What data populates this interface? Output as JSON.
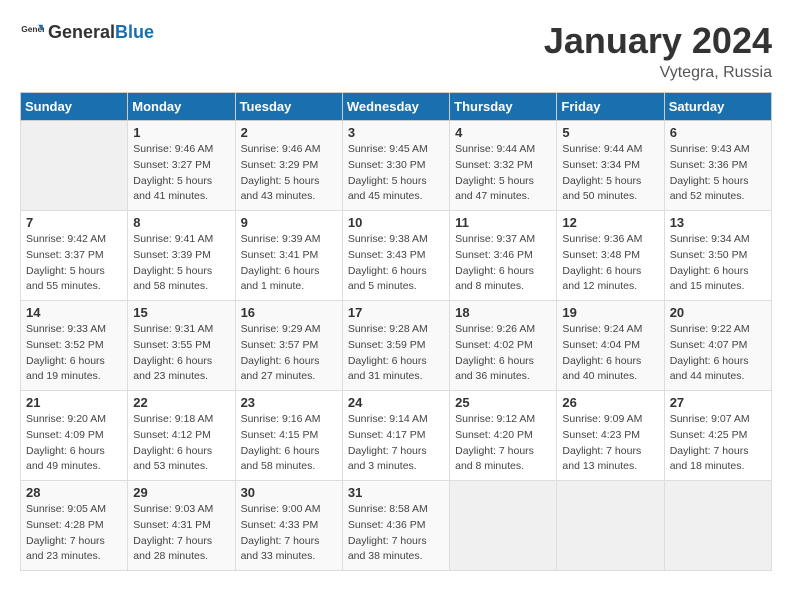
{
  "header": {
    "logo_general": "General",
    "logo_blue": "Blue",
    "month_title": "January 2024",
    "location": "Vytegra, Russia"
  },
  "days_of_week": [
    "Sunday",
    "Monday",
    "Tuesday",
    "Wednesday",
    "Thursday",
    "Friday",
    "Saturday"
  ],
  "weeks": [
    [
      {
        "day": "",
        "info": ""
      },
      {
        "day": "1",
        "info": "Sunrise: 9:46 AM\nSunset: 3:27 PM\nDaylight: 5 hours\nand 41 minutes."
      },
      {
        "day": "2",
        "info": "Sunrise: 9:46 AM\nSunset: 3:29 PM\nDaylight: 5 hours\nand 43 minutes."
      },
      {
        "day": "3",
        "info": "Sunrise: 9:45 AM\nSunset: 3:30 PM\nDaylight: 5 hours\nand 45 minutes."
      },
      {
        "day": "4",
        "info": "Sunrise: 9:44 AM\nSunset: 3:32 PM\nDaylight: 5 hours\nand 47 minutes."
      },
      {
        "day": "5",
        "info": "Sunrise: 9:44 AM\nSunset: 3:34 PM\nDaylight: 5 hours\nand 50 minutes."
      },
      {
        "day": "6",
        "info": "Sunrise: 9:43 AM\nSunset: 3:36 PM\nDaylight: 5 hours\nand 52 minutes."
      }
    ],
    [
      {
        "day": "7",
        "info": "Sunrise: 9:42 AM\nSunset: 3:37 PM\nDaylight: 5 hours\nand 55 minutes."
      },
      {
        "day": "8",
        "info": "Sunrise: 9:41 AM\nSunset: 3:39 PM\nDaylight: 5 hours\nand 58 minutes."
      },
      {
        "day": "9",
        "info": "Sunrise: 9:39 AM\nSunset: 3:41 PM\nDaylight: 6 hours\nand 1 minute."
      },
      {
        "day": "10",
        "info": "Sunrise: 9:38 AM\nSunset: 3:43 PM\nDaylight: 6 hours\nand 5 minutes."
      },
      {
        "day": "11",
        "info": "Sunrise: 9:37 AM\nSunset: 3:46 PM\nDaylight: 6 hours\nand 8 minutes."
      },
      {
        "day": "12",
        "info": "Sunrise: 9:36 AM\nSunset: 3:48 PM\nDaylight: 6 hours\nand 12 minutes."
      },
      {
        "day": "13",
        "info": "Sunrise: 9:34 AM\nSunset: 3:50 PM\nDaylight: 6 hours\nand 15 minutes."
      }
    ],
    [
      {
        "day": "14",
        "info": "Sunrise: 9:33 AM\nSunset: 3:52 PM\nDaylight: 6 hours\nand 19 minutes."
      },
      {
        "day": "15",
        "info": "Sunrise: 9:31 AM\nSunset: 3:55 PM\nDaylight: 6 hours\nand 23 minutes."
      },
      {
        "day": "16",
        "info": "Sunrise: 9:29 AM\nSunset: 3:57 PM\nDaylight: 6 hours\nand 27 minutes."
      },
      {
        "day": "17",
        "info": "Sunrise: 9:28 AM\nSunset: 3:59 PM\nDaylight: 6 hours\nand 31 minutes."
      },
      {
        "day": "18",
        "info": "Sunrise: 9:26 AM\nSunset: 4:02 PM\nDaylight: 6 hours\nand 36 minutes."
      },
      {
        "day": "19",
        "info": "Sunrise: 9:24 AM\nSunset: 4:04 PM\nDaylight: 6 hours\nand 40 minutes."
      },
      {
        "day": "20",
        "info": "Sunrise: 9:22 AM\nSunset: 4:07 PM\nDaylight: 6 hours\nand 44 minutes."
      }
    ],
    [
      {
        "day": "21",
        "info": "Sunrise: 9:20 AM\nSunset: 4:09 PM\nDaylight: 6 hours\nand 49 minutes."
      },
      {
        "day": "22",
        "info": "Sunrise: 9:18 AM\nSunset: 4:12 PM\nDaylight: 6 hours\nand 53 minutes."
      },
      {
        "day": "23",
        "info": "Sunrise: 9:16 AM\nSunset: 4:15 PM\nDaylight: 6 hours\nand 58 minutes."
      },
      {
        "day": "24",
        "info": "Sunrise: 9:14 AM\nSunset: 4:17 PM\nDaylight: 7 hours\nand 3 minutes."
      },
      {
        "day": "25",
        "info": "Sunrise: 9:12 AM\nSunset: 4:20 PM\nDaylight: 7 hours\nand 8 minutes."
      },
      {
        "day": "26",
        "info": "Sunrise: 9:09 AM\nSunset: 4:23 PM\nDaylight: 7 hours\nand 13 minutes."
      },
      {
        "day": "27",
        "info": "Sunrise: 9:07 AM\nSunset: 4:25 PM\nDaylight: 7 hours\nand 18 minutes."
      }
    ],
    [
      {
        "day": "28",
        "info": "Sunrise: 9:05 AM\nSunset: 4:28 PM\nDaylight: 7 hours\nand 23 minutes."
      },
      {
        "day": "29",
        "info": "Sunrise: 9:03 AM\nSunset: 4:31 PM\nDaylight: 7 hours\nand 28 minutes."
      },
      {
        "day": "30",
        "info": "Sunrise: 9:00 AM\nSunset: 4:33 PM\nDaylight: 7 hours\nand 33 minutes."
      },
      {
        "day": "31",
        "info": "Sunrise: 8:58 AM\nSunset: 4:36 PM\nDaylight: 7 hours\nand 38 minutes."
      },
      {
        "day": "",
        "info": ""
      },
      {
        "day": "",
        "info": ""
      },
      {
        "day": "",
        "info": ""
      }
    ]
  ]
}
